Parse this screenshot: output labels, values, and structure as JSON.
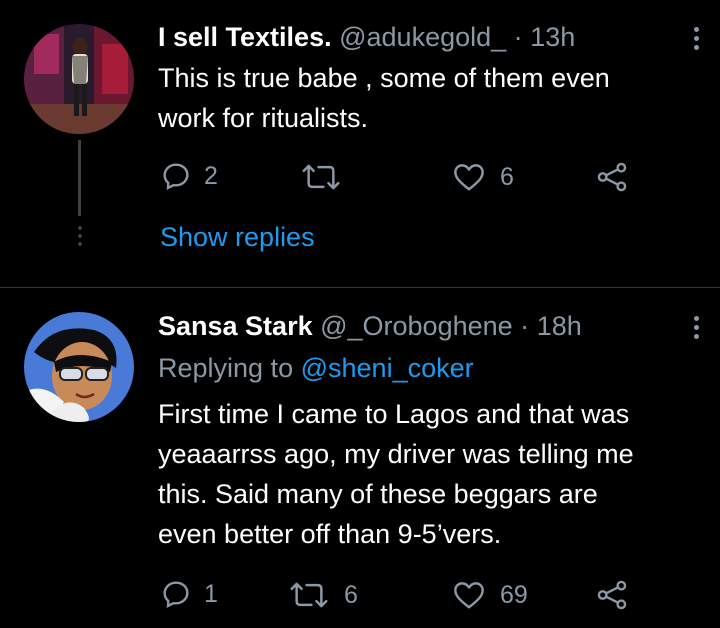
{
  "tweets": [
    {
      "display_name": "I sell Textiles.",
      "handle": "@adukegold_",
      "time": "13h",
      "separator": "·",
      "text_lines": [
        "This is true babe , some of them even",
        "work for ritualists."
      ],
      "reply_count": "2",
      "retweet_count": "",
      "like_count": "6",
      "show_replies": "Show replies"
    },
    {
      "display_name": "Sansa Stark",
      "handle": "@_Oroboghene",
      "time": "18h",
      "separator": "·",
      "replying_label": "Replying to",
      "replying_handle": "@sheni_coker",
      "text_lines": [
        "First time I came to Lagos and that was",
        "yeaaarrss ago, my driver was telling me",
        "this. Said many of these beggars are",
        "even better off than 9-5’vers."
      ],
      "reply_count": "1",
      "retweet_count": "6",
      "like_count": "69"
    }
  ],
  "colors": {
    "background": "#000000",
    "text": "#ffffff",
    "muted": "#8b98a5",
    "link": "#1d9bf0",
    "divider": "#2f3336"
  }
}
